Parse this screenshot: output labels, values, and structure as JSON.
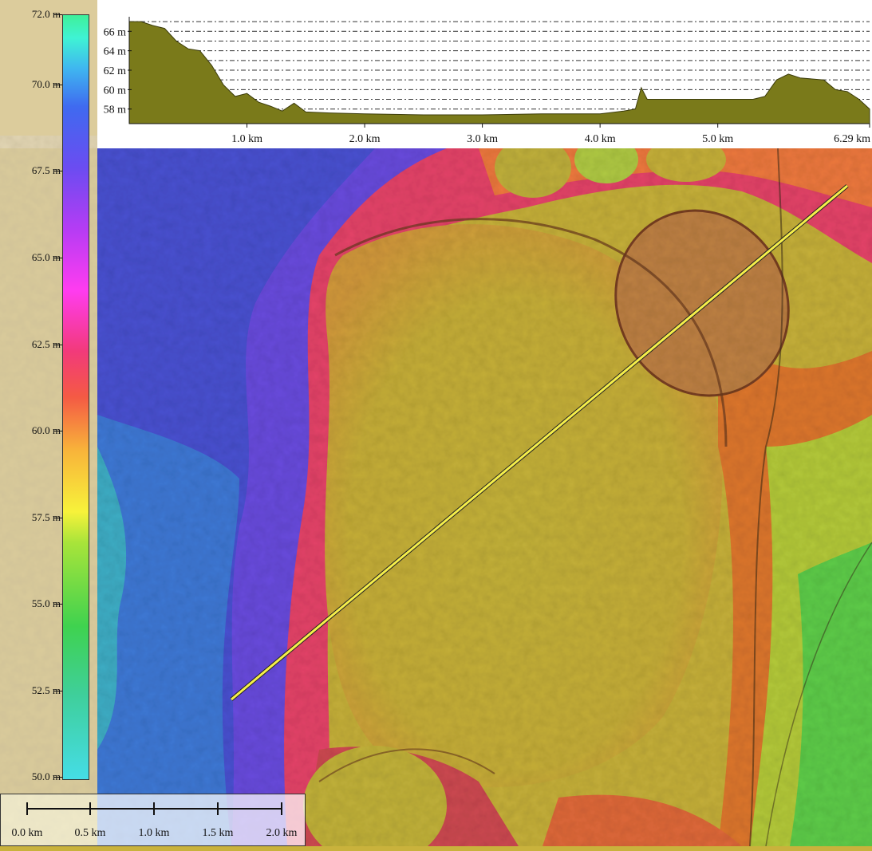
{
  "legend": {
    "labels": [
      "72.0 m",
      "70.0 m",
      "67.5 m",
      "65.0 m",
      "62.5 m",
      "60.0 m",
      "57.5 m",
      "55.0 m",
      "52.5 m",
      "50.0 m"
    ]
  },
  "chart_data": {
    "type": "area",
    "y_ticks": [
      "66 m",
      "64 m",
      "62 m",
      "60 m",
      "58 m"
    ],
    "x_ticks": [
      "1.0 km",
      "2.0 km",
      "3.0 km",
      "4.0 km",
      "5.0 km",
      "6.29 km"
    ],
    "x_unit": "km",
    "y_unit": "m",
    "xlim": [
      0,
      6.29
    ],
    "ylim": [
      56.5,
      67.5
    ],
    "grid": true,
    "fill_color": "#7a7a1a",
    "profile": {
      "x": [
        0.0,
        0.1,
        0.2,
        0.3,
        0.4,
        0.5,
        0.6,
        0.7,
        0.8,
        0.9,
        1.0,
        1.1,
        1.2,
        1.3,
        1.4,
        1.5,
        1.7,
        2.0,
        2.5,
        3.0,
        3.5,
        4.0,
        4.2,
        4.3,
        4.35,
        4.4,
        4.5,
        5.0,
        5.3,
        5.4,
        5.5,
        5.6,
        5.7,
        5.8,
        5.9,
        6.0,
        6.1,
        6.2,
        6.29
      ],
      "y": [
        67.0,
        67.0,
        66.6,
        66.3,
        65.0,
        64.2,
        64.0,
        62.5,
        60.5,
        59.3,
        59.6,
        58.7,
        58.3,
        57.8,
        58.6,
        57.7,
        57.6,
        57.5,
        57.4,
        57.4,
        57.5,
        57.5,
        57.8,
        58.0,
        60.2,
        59.0,
        59.0,
        59.0,
        59.0,
        59.3,
        61.0,
        61.6,
        61.2,
        61.1,
        61.0,
        60.0,
        59.8,
        59.0,
        58.0
      ]
    }
  },
  "scale_bar": {
    "labels": [
      "0.0 km",
      "0.5 km",
      "1.0 km",
      "1.5 km",
      "2.0 km"
    ]
  },
  "map": {
    "transect_color": "#f5ef4a"
  }
}
